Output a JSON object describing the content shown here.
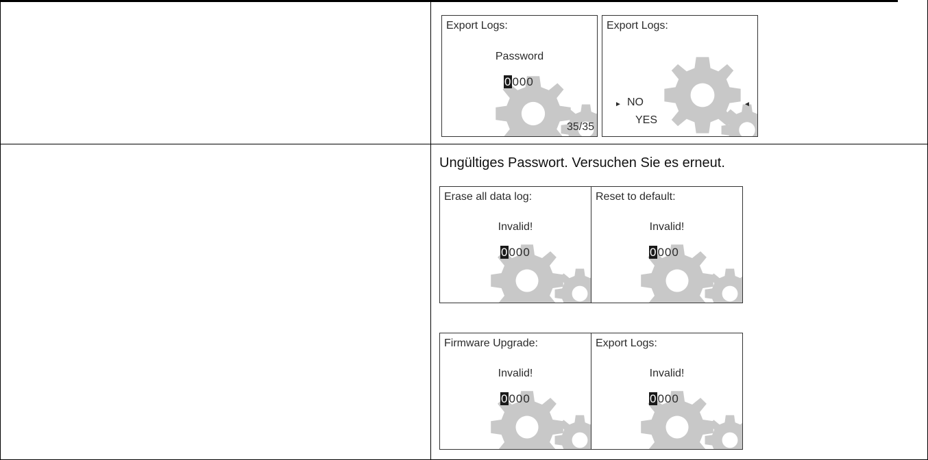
{
  "export_screens": {
    "password": {
      "title": "Export Logs:",
      "prompt": "Password",
      "digit_cursor": "0",
      "digits_rest": "000",
      "page_indicator": "35/35"
    },
    "confirm": {
      "title": "Export Logs:",
      "option_no": "NO",
      "option_yes": "YES",
      "arrow_left": "►",
      "arrow_right": "◄"
    }
  },
  "message": "Ungültiges Passwort. Versuchen Sie es erneut.",
  "invalid_screens": [
    {
      "title": "Erase all data log:",
      "status": "Invalid!",
      "digit_cursor": "0",
      "digits_rest": "000"
    },
    {
      "title": "Reset to default:",
      "status": "Invalid!",
      "digit_cursor": "0",
      "digits_rest": "000"
    },
    {
      "title": "Firmware Upgrade:",
      "status": "Invalid!",
      "digit_cursor": "0",
      "digits_rest": "000"
    },
    {
      "title": "Export Logs:",
      "status": "Invalid!",
      "digit_cursor": "0",
      "digits_rest": "000"
    }
  ],
  "icons": {
    "gear": "gear-icon"
  },
  "colors": {
    "gear": "#c8c8c8",
    "border": "#000000"
  }
}
